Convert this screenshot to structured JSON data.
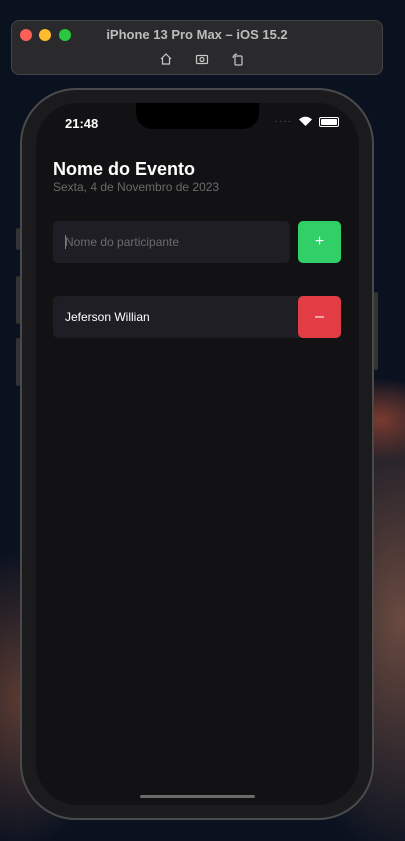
{
  "simulator": {
    "title": "iPhone 13 Pro Max – iOS 15.2",
    "tools": [
      "home-icon",
      "screenshot-icon",
      "rotate-icon"
    ]
  },
  "status_bar": {
    "time": "21:48"
  },
  "event": {
    "name": "Nome do Evento",
    "date": "Sexta, 4 de Novembro de 2023"
  },
  "form": {
    "placeholder": "Nome do participante",
    "add_label": "+"
  },
  "participants": [
    {
      "name": "Jeferson Willian",
      "remove_label": "–"
    }
  ],
  "colors": {
    "background": "#121214",
    "input_bg": "#1f1e25",
    "add": "#31cf67",
    "remove": "#e23c44"
  }
}
